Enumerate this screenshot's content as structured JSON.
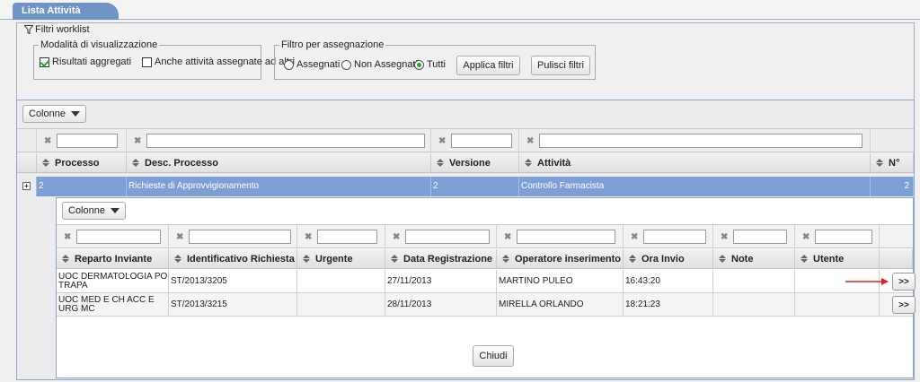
{
  "tab": {
    "title": "Lista Attività"
  },
  "filters": {
    "legend": "Filtri worklist",
    "visual": {
      "legend": "Modalità di visualizzazione",
      "aggregated_label": "Risultati aggregati",
      "aggregated_checked": true,
      "others_label": "Anche attività assegnate ad altri",
      "others_checked": false
    },
    "assign": {
      "legend": "Filtro per assegnazione",
      "options": [
        "Assegnati",
        "Non Assegnati",
        "Tutti"
      ],
      "selected": "Tutti",
      "apply_label": "Applica filtri",
      "clear_label": "Pulisci filtri"
    }
  },
  "main_grid": {
    "columns_button": "Colonne",
    "headers": [
      "Processo",
      "Desc. Processo",
      "Versione",
      "Attività",
      "N°"
    ],
    "row": {
      "expander": "+",
      "processo": "2",
      "desc": "Richieste di Approvvigionamento",
      "versione": "2",
      "attivita": "Controllo Farmacista",
      "num": "2"
    }
  },
  "sub_grid": {
    "columns_button": "Colonne",
    "headers": [
      "Reparto Inviante",
      "Identificativo Richiesta",
      "Urgente",
      "Data Registrazione",
      "Operatore inserimento",
      "Ora Invio",
      "Note",
      "Utente"
    ],
    "rows": [
      {
        "reparto": "UOC DERMATOLOGIA PO TRAPA",
        "id": "ST/2013/3205",
        "urgente": "",
        "data": "27/11/2013",
        "operatore": "MARTINO PULEO",
        "ora": "16:43:20",
        "note": "",
        "utente": "",
        "action": ">>"
      },
      {
        "reparto": "UOC MED E CH ACC E URG MC",
        "id": "ST/2013/3215",
        "urgente": "",
        "data": "28/11/2013",
        "operatore": "MIRELLA ORLANDO",
        "ora": "18:21:23",
        "note": "",
        "utente": "",
        "action": ">>"
      }
    ],
    "close_label": "Chiudi"
  },
  "colors": {
    "tab": "#6f93c4",
    "selected_row": "#7e9fd6",
    "arrow": "#e02020"
  }
}
